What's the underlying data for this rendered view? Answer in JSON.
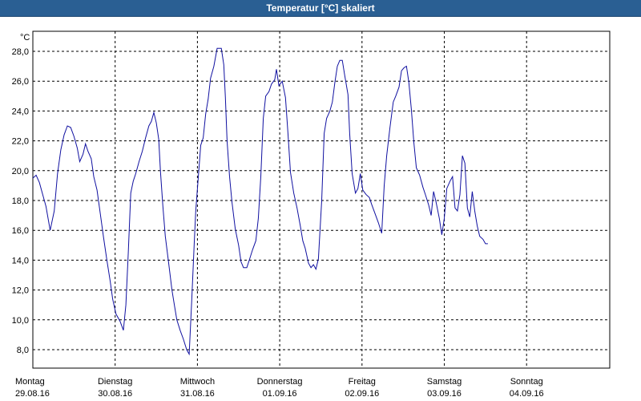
{
  "window": {
    "title": "Temperatur [°C] skaliert"
  },
  "colors": {
    "titlebar": "#2a5f93",
    "line": "#1010a0",
    "grid": "#000000"
  },
  "chart_data": {
    "type": "line",
    "title": "Temperatur [°C] skaliert",
    "ylabel": "°C",
    "xlabel": "",
    "ylim": [
      7,
      29
    ],
    "xlim": [
      0,
      7.3
    ],
    "y_ticks": [
      "8,0",
      "10,0",
      "12,0",
      "14,0",
      "16,0",
      "18,0",
      "20,0",
      "22,0",
      "24,0",
      "26,0",
      "28,0"
    ],
    "y_tick_values": [
      8,
      10,
      12,
      14,
      16,
      18,
      20,
      22,
      24,
      26,
      28
    ],
    "x_ticks": [
      {
        "day": "Montag",
        "date": "29.08.16"
      },
      {
        "day": "Dienstag",
        "date": "30.08.16"
      },
      {
        "day": "Mittwoch",
        "date": "31.08.16"
      },
      {
        "day": "Donnerstag",
        "date": "01.09.16"
      },
      {
        "day": "Freitag",
        "date": "02.09.16"
      },
      {
        "day": "Samstag",
        "date": "03.09.16"
      },
      {
        "day": "Sonntag",
        "date": "04.09.16"
      }
    ],
    "grid": true,
    "series": [
      {
        "values": [
          [
            0.0,
            19.5
          ],
          [
            0.04,
            19.7
          ],
          [
            0.08,
            19.2
          ],
          [
            0.12,
            18.4
          ],
          [
            0.16,
            17.6
          ],
          [
            0.21,
            16.0
          ],
          [
            0.26,
            17.3
          ],
          [
            0.3,
            19.8
          ],
          [
            0.34,
            21.4
          ],
          [
            0.38,
            22.4
          ],
          [
            0.42,
            23.0
          ],
          [
            0.46,
            22.9
          ],
          [
            0.5,
            22.3
          ],
          [
            0.54,
            21.5
          ],
          [
            0.57,
            20.6
          ],
          [
            0.61,
            21.1
          ],
          [
            0.64,
            21.8
          ],
          [
            0.67,
            21.3
          ],
          [
            0.71,
            20.8
          ],
          [
            0.74,
            19.6
          ],
          [
            0.78,
            18.7
          ],
          [
            0.82,
            17.1
          ],
          [
            0.86,
            15.5
          ],
          [
            0.9,
            14.0
          ],
          [
            0.94,
            12.6
          ],
          [
            0.97,
            11.4
          ],
          [
            1.01,
            10.4
          ],
          [
            1.06,
            9.9
          ],
          [
            1.1,
            9.3
          ],
          [
            1.13,
            11.0
          ],
          [
            1.16,
            14.5
          ],
          [
            1.19,
            18.5
          ],
          [
            1.22,
            19.3
          ],
          [
            1.25,
            19.8
          ],
          [
            1.29,
            20.6
          ],
          [
            1.33,
            21.3
          ],
          [
            1.37,
            22.2
          ],
          [
            1.41,
            23.0
          ],
          [
            1.44,
            23.3
          ],
          [
            1.47,
            23.9
          ],
          [
            1.5,
            23.2
          ],
          [
            1.53,
            22.1
          ],
          [
            1.55,
            20.0
          ],
          [
            1.58,
            17.6
          ],
          [
            1.61,
            15.6
          ],
          [
            1.65,
            13.8
          ],
          [
            1.69,
            12.0
          ],
          [
            1.72,
            11.0
          ],
          [
            1.75,
            10.0
          ],
          [
            1.79,
            9.3
          ],
          [
            1.83,
            8.7
          ],
          [
            1.87,
            8.0
          ],
          [
            1.9,
            7.7
          ],
          [
            1.93,
            11.2
          ],
          [
            1.96,
            15.0
          ],
          [
            1.98,
            17.3
          ],
          [
            2.01,
            19.5
          ],
          [
            2.04,
            21.7
          ],
          [
            2.07,
            22.2
          ],
          [
            2.1,
            23.8
          ],
          [
            2.13,
            24.8
          ],
          [
            2.16,
            26.2
          ],
          [
            2.2,
            27.0
          ],
          [
            2.24,
            28.2
          ],
          [
            2.29,
            28.2
          ],
          [
            2.32,
            27.1
          ],
          [
            2.34,
            24.9
          ],
          [
            2.36,
            22.0
          ],
          [
            2.39,
            19.6
          ],
          [
            2.42,
            17.9
          ],
          [
            2.46,
            16.1
          ],
          [
            2.5,
            15.0
          ],
          [
            2.53,
            13.9
          ],
          [
            2.56,
            13.5
          ],
          [
            2.6,
            13.5
          ],
          [
            2.63,
            14.0
          ],
          [
            2.67,
            14.7
          ],
          [
            2.71,
            15.3
          ],
          [
            2.74,
            16.8
          ],
          [
            2.77,
            19.6
          ],
          [
            2.8,
            23.5
          ],
          [
            2.83,
            25.0
          ],
          [
            2.87,
            25.3
          ],
          [
            2.9,
            25.8
          ],
          [
            2.94,
            26.1
          ],
          [
            2.96,
            26.8
          ],
          [
            2.99,
            25.7
          ],
          [
            3.03,
            26.0
          ],
          [
            3.07,
            24.9
          ],
          [
            3.1,
            22.5
          ],
          [
            3.13,
            19.9
          ],
          [
            3.17,
            18.5
          ],
          [
            3.21,
            17.5
          ],
          [
            3.25,
            16.3
          ],
          [
            3.28,
            15.3
          ],
          [
            3.31,
            14.8
          ],
          [
            3.35,
            13.8
          ],
          [
            3.38,
            13.5
          ],
          [
            3.41,
            13.7
          ],
          [
            3.44,
            13.4
          ],
          [
            3.47,
            14.1
          ],
          [
            3.51,
            18.0
          ],
          [
            3.54,
            22.5
          ],
          [
            3.57,
            23.5
          ],
          [
            3.61,
            24.0
          ],
          [
            3.64,
            24.6
          ],
          [
            3.67,
            25.9
          ],
          [
            3.7,
            27.0
          ],
          [
            3.73,
            27.4
          ],
          [
            3.76,
            27.4
          ],
          [
            3.79,
            26.4
          ],
          [
            3.83,
            25.1
          ],
          [
            3.85,
            22.5
          ],
          [
            3.88,
            19.8
          ],
          [
            3.92,
            18.5
          ],
          [
            3.95,
            18.8
          ],
          [
            3.98,
            19.8
          ],
          [
            4.01,
            18.7
          ],
          [
            4.05,
            18.4
          ],
          [
            4.09,
            18.2
          ],
          [
            4.12,
            17.7
          ],
          [
            4.16,
            17.1
          ],
          [
            4.2,
            16.5
          ],
          [
            4.24,
            15.8
          ],
          [
            4.27,
            19.0
          ],
          [
            4.3,
            21.0
          ],
          [
            4.34,
            22.9
          ],
          [
            4.38,
            24.6
          ],
          [
            4.41,
            25.0
          ],
          [
            4.45,
            25.6
          ],
          [
            4.48,
            26.7
          ],
          [
            4.51,
            26.9
          ],
          [
            4.54,
            27.0
          ],
          [
            4.57,
            25.9
          ],
          [
            4.6,
            24.1
          ],
          [
            4.63,
            21.9
          ],
          [
            4.66,
            20.2
          ],
          [
            4.7,
            19.7
          ],
          [
            4.74,
            18.9
          ],
          [
            4.77,
            18.4
          ],
          [
            4.81,
            17.7
          ],
          [
            4.84,
            17.0
          ],
          [
            4.87,
            18.6
          ],
          [
            4.9,
            17.9
          ],
          [
            4.94,
            16.8
          ],
          [
            4.97,
            15.7
          ],
          [
            5.0,
            16.8
          ],
          [
            5.03,
            18.8
          ],
          [
            5.07,
            19.3
          ],
          [
            5.1,
            19.6
          ],
          [
            5.13,
            17.5
          ],
          [
            5.16,
            17.3
          ],
          [
            5.19,
            18.4
          ],
          [
            5.22,
            21.0
          ],
          [
            5.25,
            20.5
          ],
          [
            5.28,
            17.5
          ],
          [
            5.31,
            16.9
          ],
          [
            5.34,
            18.6
          ],
          [
            5.37,
            17.3
          ],
          [
            5.4,
            16.3
          ],
          [
            5.43,
            15.6
          ],
          [
            5.47,
            15.4
          ],
          [
            5.5,
            15.1
          ],
          [
            5.53,
            15.1
          ]
        ]
      }
    ]
  }
}
